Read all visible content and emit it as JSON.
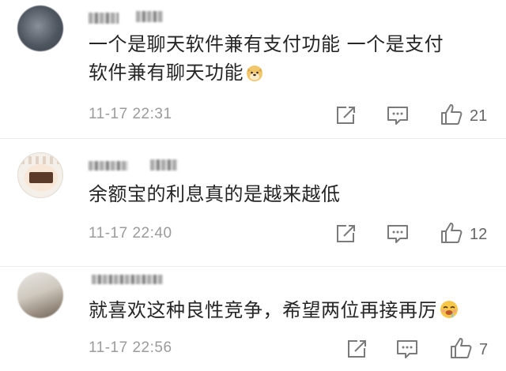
{
  "comments": [
    {
      "text_line1": "一个是聊天软件兼有支付功能 一个是支付",
      "text_line2": "软件兼有聊天功能",
      "emoji": "doge-emoji",
      "time": "11-17 22:31",
      "likes": "21"
    },
    {
      "text_line1": "余额宝的利息真的是越来越低",
      "time": "11-17 22:40",
      "likes": "12"
    },
    {
      "text_line1": "就喜欢这种良性竞争，希望两位再接再厉",
      "emoji": "drooling-emoji",
      "time": "11-17 22:56",
      "likes": "7"
    }
  ],
  "icons": {
    "share": "share-icon",
    "reply": "comment-icon",
    "like": "thumbs-up-icon"
  },
  "colors": {
    "text": "#262626",
    "meta": "#9b9b9b",
    "icon": "#7a7a7a",
    "divider": "#ececec"
  }
}
